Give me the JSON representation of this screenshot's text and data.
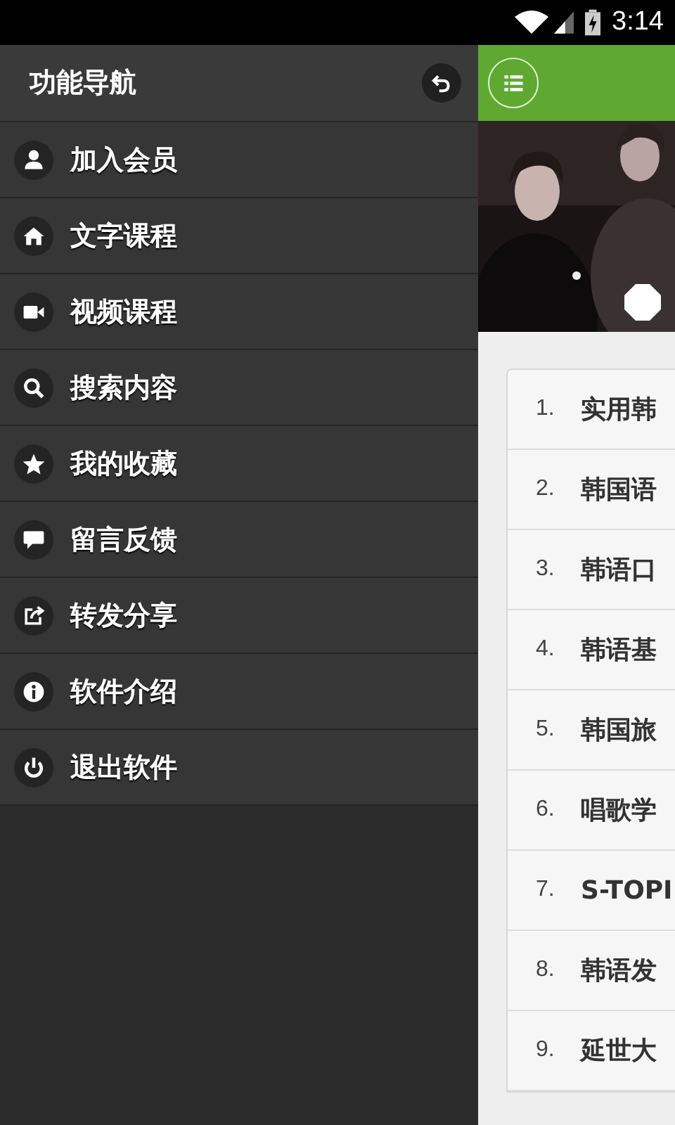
{
  "status_bar": {
    "time": "3:14"
  },
  "drawer": {
    "title": "功能导航",
    "items": [
      {
        "label": "加入会员",
        "kind": "person"
      },
      {
        "label": "文字课程",
        "kind": "home"
      },
      {
        "label": "视频课程",
        "kind": "video"
      },
      {
        "label": "搜索内容",
        "kind": "search"
      },
      {
        "label": "我的收藏",
        "kind": "star"
      },
      {
        "label": "留言反馈",
        "kind": "comment"
      },
      {
        "label": "转发分享",
        "kind": "share"
      },
      {
        "label": "软件介绍",
        "kind": "info"
      },
      {
        "label": "退出软件",
        "kind": "power"
      }
    ]
  },
  "lessons": [
    {
      "number": "1.",
      "title": "实用韩"
    },
    {
      "number": "2.",
      "title": "韩国语"
    },
    {
      "number": "3.",
      "title": "韩语口"
    },
    {
      "number": "4.",
      "title": "韩语基"
    },
    {
      "number": "5.",
      "title": "韩国旅"
    },
    {
      "number": "6.",
      "title": "唱歌学"
    },
    {
      "number": "7.",
      "title": "S-TOPI"
    },
    {
      "number": "8.",
      "title": "韩语发"
    },
    {
      "number": "9.",
      "title": "延世大"
    }
  ]
}
